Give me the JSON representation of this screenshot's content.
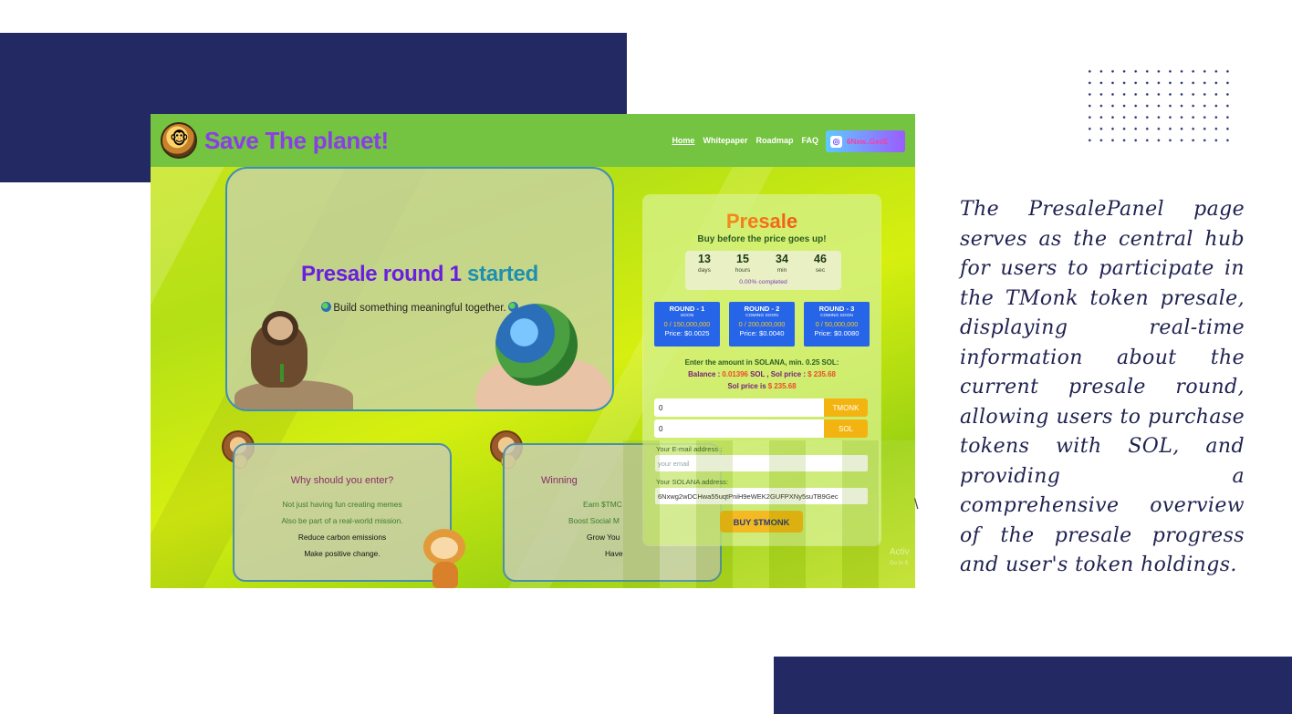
{
  "nav": {
    "brand": "Save The planet!",
    "links": [
      "Home",
      "Whitepaper",
      "Roadmap",
      "FAQ"
    ],
    "wallet_label": "6Nxw..GecE"
  },
  "hero": {
    "title_part1": "Presale round 1",
    "title_part2": "started",
    "subtitle": "Build something meaningful together."
  },
  "cards": [
    {
      "title": "Why should you enter?",
      "lines": [
        "Not just having fun creating memes",
        "Also be part of a real-world mission.",
        "Reduce carbon emissions",
        "Make positive change."
      ]
    },
    {
      "title": "Winning",
      "lines": [
        "Earn $TMC",
        "Boost Social M",
        "Grow You",
        "Have"
      ]
    }
  ],
  "presale": {
    "title": "Presale",
    "subtitle": "Buy before the price goes up!",
    "countdown": [
      {
        "value": "13",
        "label": "days"
      },
      {
        "value": "15",
        "label": "hours"
      },
      {
        "value": "34",
        "label": "min"
      },
      {
        "value": "46",
        "label": "sec"
      }
    ],
    "completed": "0.00% completed",
    "rounds": [
      {
        "name": "ROUND - 1",
        "status": "SOON",
        "amount": "0 / 150,000,000",
        "price": "Price: $0.0025"
      },
      {
        "name": "ROUND - 2",
        "status": "COMING SOON",
        "amount": "0 / 200,000,000",
        "price": "Price: $0.0040"
      },
      {
        "name": "ROUND - 3",
        "status": "COMING SOON",
        "amount": "0 / 50,000,000",
        "price": "Price: $0.0080"
      }
    ],
    "instruction": "Enter the amount in SOLANA, min. 0.25 SOL:",
    "balance_label": "Balance :",
    "balance_value": "0.01396",
    "balance_unit": "SOL , Sol price :",
    "sol_price_value": "$ 235.68",
    "sol_price_label": "Sol price is",
    "tmonk_amount": "0",
    "tmonk_unit": "TMONK",
    "sol_amount": "0",
    "sol_unit": "SOL",
    "email_label": "Your E-mail address :",
    "email_placeholder": "your email",
    "solana_label": "Your SOLANA address:",
    "solana_address": "6Nxwg2wDCHwa55uqtPniH9eWEK2GUFPXNy5suTB9Gec",
    "buy_label": "BUY $TMONK"
  },
  "overlay": {
    "activate_text": "Activ",
    "activate_sub": "Go to S",
    "stray": "\\"
  },
  "slide": {
    "caption": "The PresalePanel page serves as the central hub for users to participate in the TMonk token presale, displaying real-time information about the current presale round, allowing users to purchase tokens with SOL, and providing a comprehensive overview of the presale progress and user's token holdings."
  }
}
